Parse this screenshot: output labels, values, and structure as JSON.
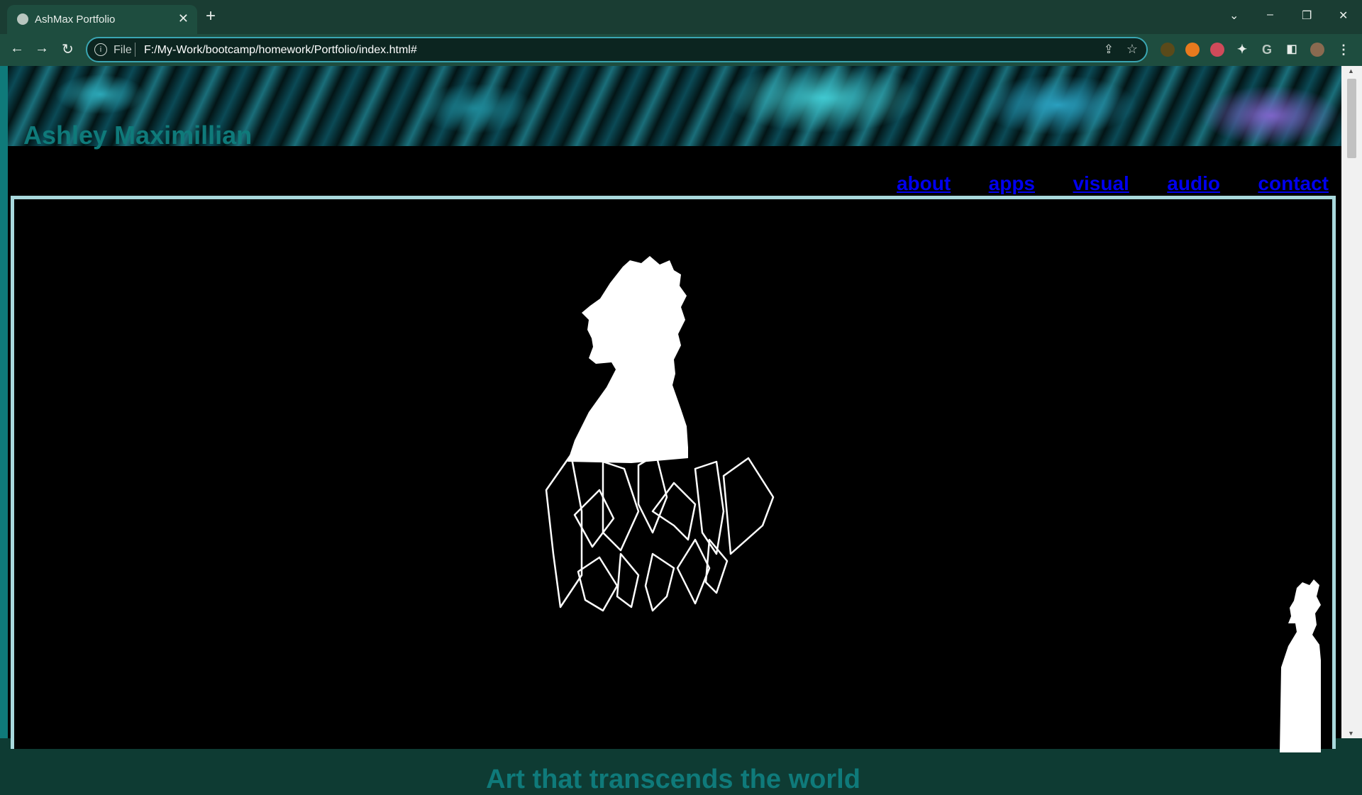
{
  "browser": {
    "tab_title": "AshMax Portfolio",
    "tab_close": "✕",
    "new_tab": "+",
    "scheme_label": "File",
    "url": "F:/My-Work/bootcamp/homework/Portfolio/index.html#",
    "window_controls": [
      "⌄",
      "–",
      "❐",
      "✕"
    ],
    "nav": {
      "back": "←",
      "forward": "→",
      "reload": "↻"
    }
  },
  "site": {
    "title": "Ashley Maximillian",
    "nav": [
      "about",
      "apps",
      "visual",
      "audio",
      "contact"
    ],
    "tagline": "Art that transcends the world"
  },
  "colors": {
    "accent_teal": "#0f7a7a",
    "link_blue": "#0000ee",
    "hero_border": "#a8d8dc",
    "page_bg": "#000000"
  }
}
